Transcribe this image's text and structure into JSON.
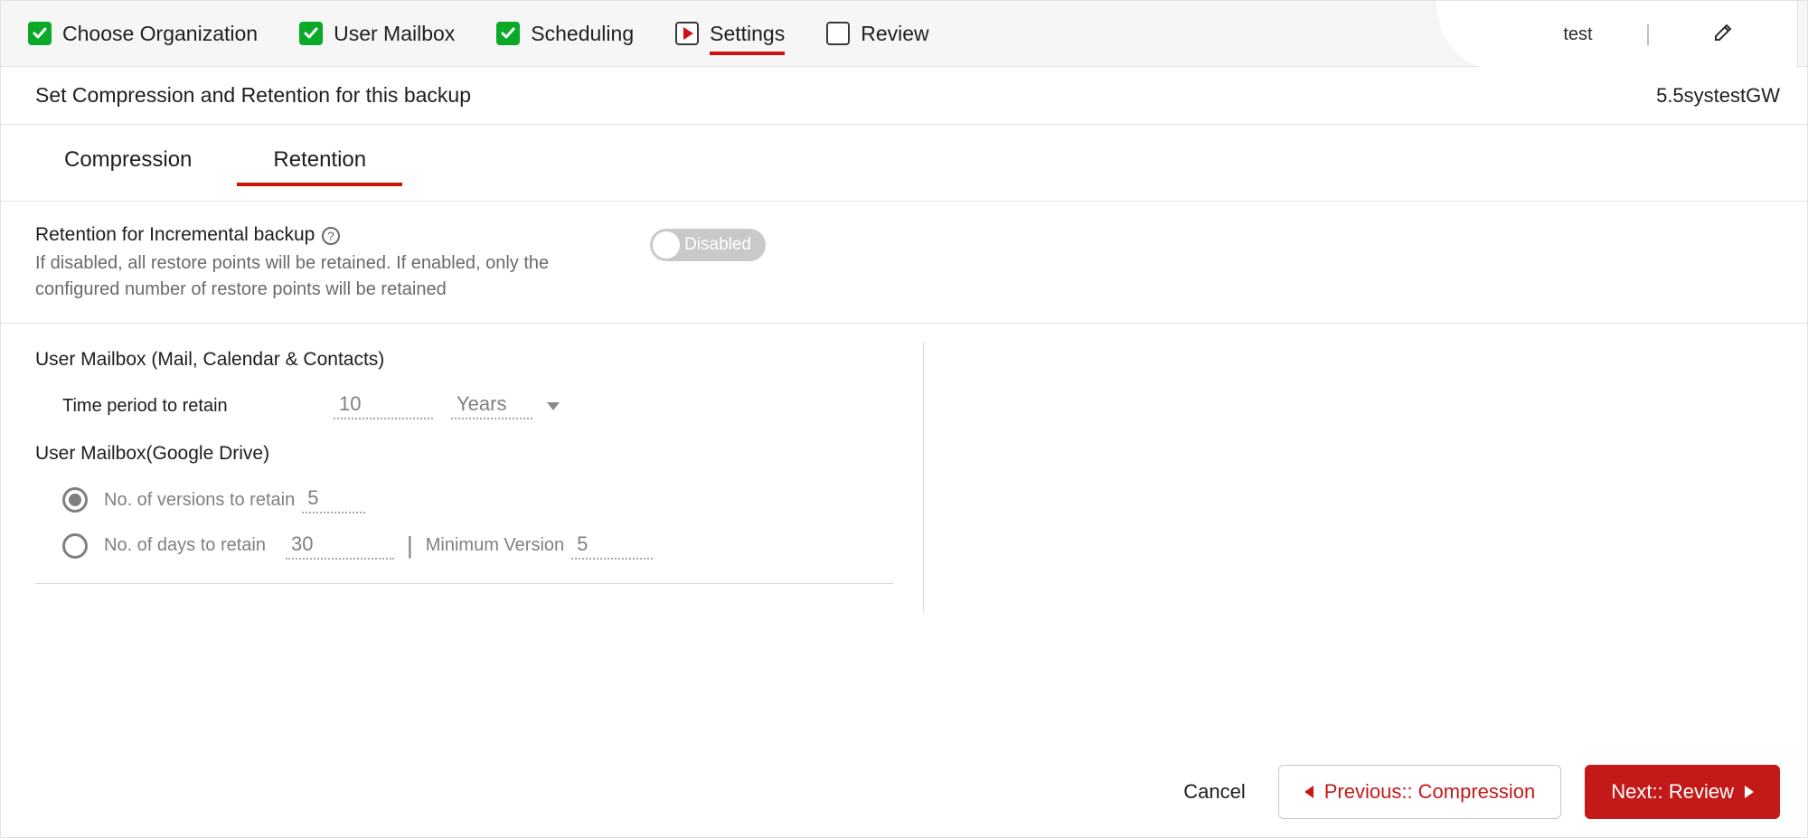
{
  "steps": {
    "org": {
      "label": "Choose Organization",
      "state": "done"
    },
    "mailbox": {
      "label": "User Mailbox",
      "state": "done"
    },
    "schedule": {
      "label": "Scheduling",
      "state": "done"
    },
    "settings": {
      "label": "Settings",
      "state": "current"
    },
    "review": {
      "label": "Review",
      "state": "todo"
    }
  },
  "job_name": "test",
  "page_title": "Set Compression and Retention for this backup",
  "storage_label": "5.5systestGW",
  "subtabs": {
    "compression": "Compression",
    "retention": "Retention",
    "active": "retention"
  },
  "retention_toggle": {
    "label": "Retention for Incremental backup",
    "desc": "If disabled, all restore points will be retained. If enabled, only the configured number of restore points will be retained",
    "state_label": "Disabled"
  },
  "mail_section": {
    "title": "User Mailbox (Mail, Calendar & Contacts)",
    "time_label": "Time period to retain",
    "time_value": "10",
    "time_unit": "Years"
  },
  "drive_section": {
    "title": "User Mailbox(Google Drive)",
    "versions_label": "No. of versions to retain",
    "versions_value": "5",
    "days_label": "No. of days to retain",
    "days_value": "30",
    "min_ver_label": "Minimum Version",
    "min_ver_value": "5"
  },
  "footer": {
    "cancel": "Cancel",
    "prev": "Previous:: Compression",
    "next": "Next:: Review"
  }
}
